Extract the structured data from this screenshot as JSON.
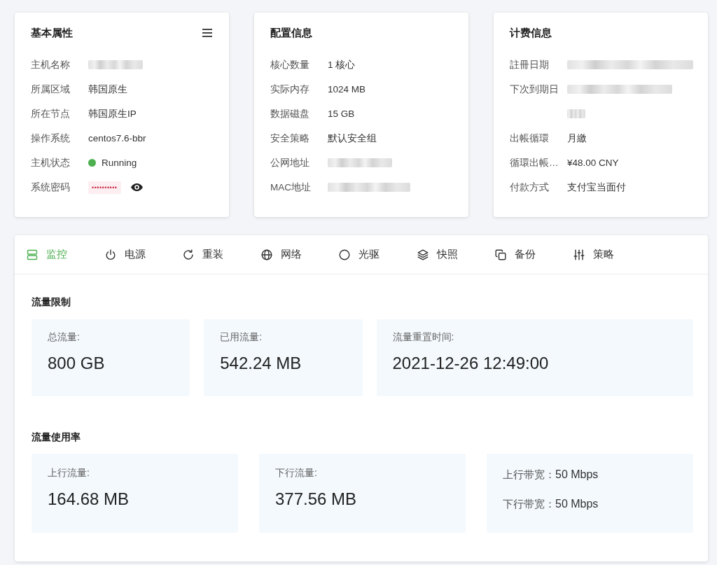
{
  "cards": [
    {
      "title": "基本属性",
      "menu": true,
      "rows": [
        {
          "label": "主机名称",
          "kind": "redacted"
        },
        {
          "label": "所属区域",
          "kind": "text",
          "value": "韩国原生"
        },
        {
          "label": "所在节点",
          "kind": "text",
          "value": "韩国原生IP"
        },
        {
          "label": "操作系统",
          "kind": "text",
          "value": "centos7.6-bbr"
        },
        {
          "label": "主机状态",
          "kind": "status",
          "value": "Running",
          "color": "#4caf50"
        },
        {
          "label": "系统密码",
          "kind": "password",
          "value": "••••••••••"
        }
      ]
    },
    {
      "title": "配置信息",
      "menu": false,
      "rows": [
        {
          "label": "核心数量",
          "kind": "text",
          "value": "1 核心"
        },
        {
          "label": "实际内存",
          "kind": "text",
          "value": "1024 MB"
        },
        {
          "label": "数据磁盘",
          "kind": "text",
          "value": "15 GB"
        },
        {
          "label": "安全策略",
          "kind": "text",
          "value": "默认安全组"
        },
        {
          "label": "公网地址",
          "kind": "redacted"
        },
        {
          "label": "MAC地址",
          "kind": "redacted"
        }
      ]
    },
    {
      "title": "计费信息",
      "menu": false,
      "rows": [
        {
          "label": "註冊日期",
          "kind": "redacted"
        },
        {
          "label": "下次到期日",
          "kind": "redacted_wrapped"
        },
        {
          "label": "出帳循環",
          "kind": "text",
          "value": "月繳"
        },
        {
          "label": "循環出帳…",
          "kind": "text",
          "value": "¥48.00 CNY"
        },
        {
          "label": "付款方式",
          "kind": "text",
          "value": "支付宝当面付"
        }
      ]
    }
  ],
  "tabs": [
    {
      "label": "监控",
      "selected": true
    },
    {
      "label": "电源",
      "selected": false
    },
    {
      "label": "重装",
      "selected": false
    },
    {
      "label": "网络",
      "selected": false
    },
    {
      "label": "光驱",
      "selected": false
    },
    {
      "label": "快照",
      "selected": false
    },
    {
      "label": "备份",
      "selected": false
    },
    {
      "label": "策略",
      "selected": false
    }
  ],
  "sections": [
    {
      "title": "流量限制",
      "stats": [
        {
          "kind": "metric",
          "label": "总流量:",
          "value": "800 GB"
        },
        {
          "kind": "metric",
          "label": "已用流量:",
          "value": "542.24 MB"
        },
        {
          "kind": "metric",
          "label": "流量重置时间:",
          "value": "2021-12-26 12:49:00"
        }
      ]
    },
    {
      "title": "流量使用率",
      "stats": [
        {
          "kind": "metric",
          "label": "上行流量:",
          "value": "164.68 MB"
        },
        {
          "kind": "metric",
          "label": "下行流量:",
          "value": "377.56 MB"
        },
        {
          "kind": "pair",
          "lines": [
            {
              "label": "上行带宽：",
              "value": "50 Mbps"
            },
            {
              "label": "下行带宽：",
              "value": "50 Mbps"
            }
          ]
        }
      ]
    }
  ]
}
